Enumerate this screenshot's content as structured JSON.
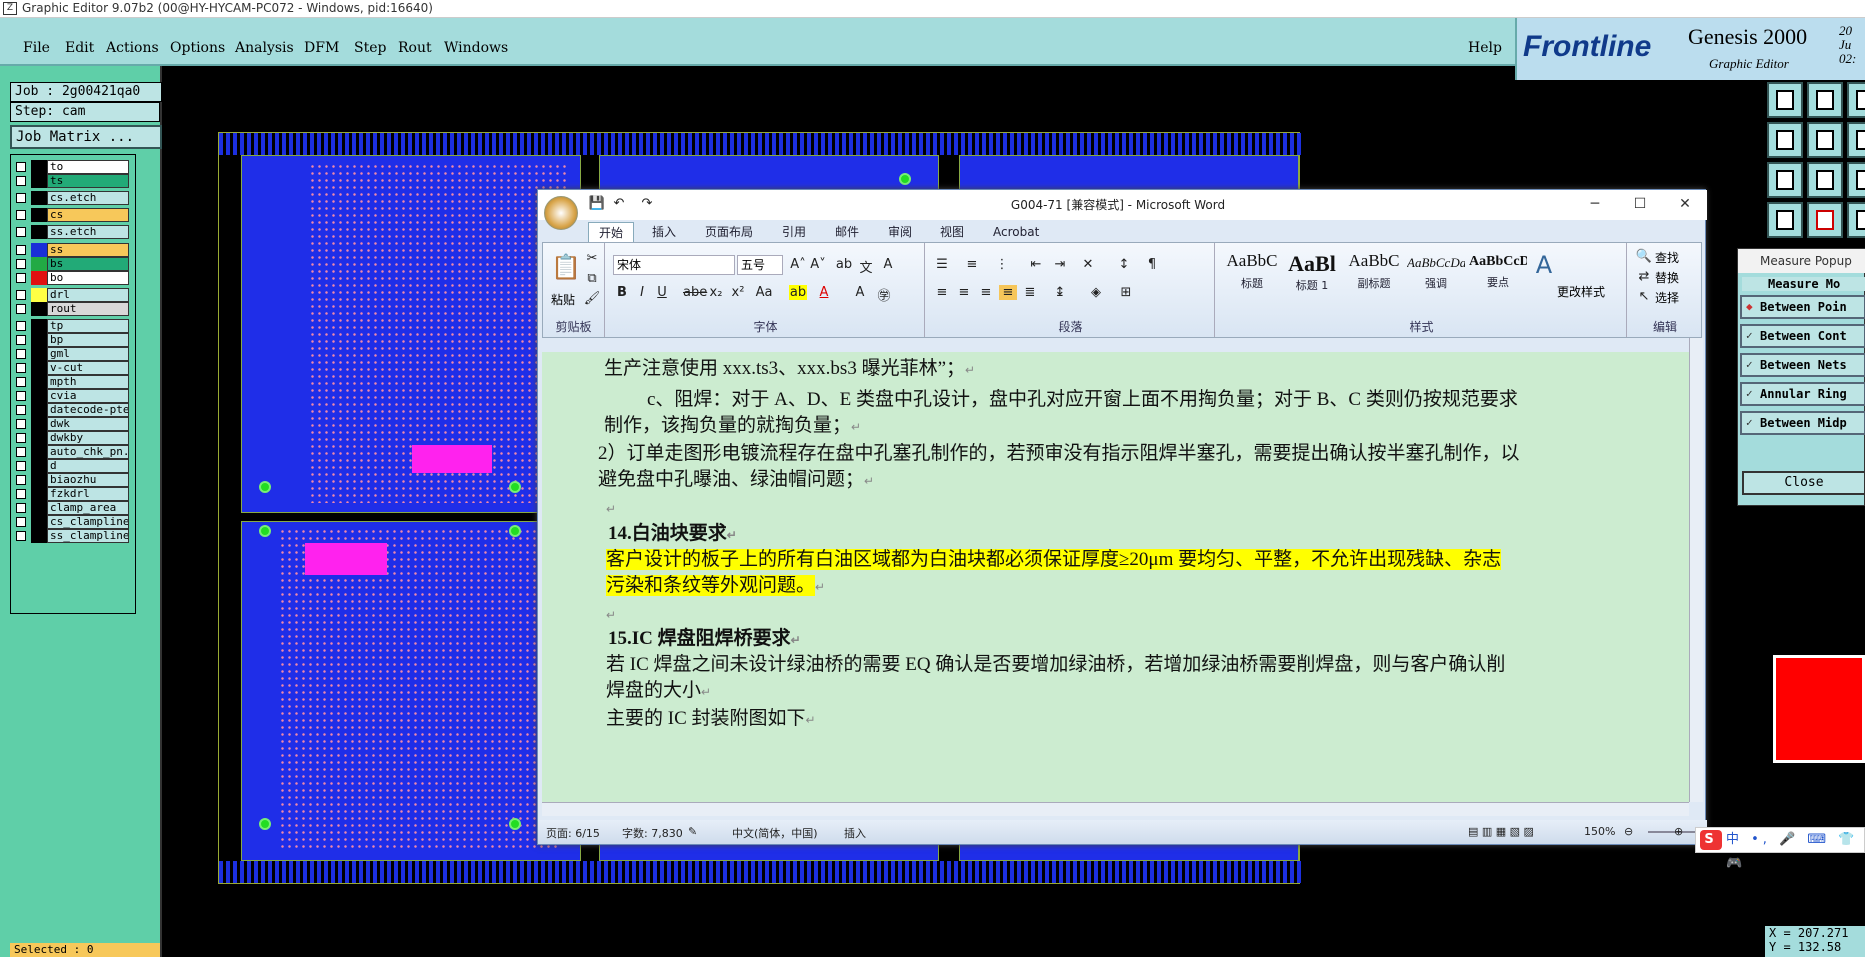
{
  "app": {
    "window_title": "Graphic Editor 9.07b2 (00@HY-HYCAM-PC072 - Windows, pid:16640)",
    "menu": [
      "File",
      "Edit",
      "Actions",
      "Options",
      "Analysis",
      "DFM",
      "Step",
      "Rout",
      "Windows"
    ],
    "help": "Help",
    "logo_brand": "Frontline",
    "logo_product": "Genesis 2000",
    "logo_sub": "Graphic Editor",
    "logo_date_1": "20 Ju",
    "logo_date_2": "02:"
  },
  "left": {
    "job": "Job : 2g00421qa0",
    "step": "Step: cam",
    "matrix": "Job Matrix ...",
    "selected": "Selected : 0",
    "layers": [
      {
        "name": "to",
        "color": "#000000",
        "bg": "#ffffff"
      },
      {
        "name": "ts",
        "color": "#000000",
        "bg": "#22aa77"
      },
      {
        "name": "cs.etch",
        "color": "#000000",
        "bg": "#bde4e4"
      },
      {
        "name": "cs",
        "color": "#000000",
        "bg": "#f7c85a"
      },
      {
        "name": "ss.etch",
        "color": "#000000",
        "bg": "#bde4e4"
      },
      {
        "name": "ss",
        "color": "#1a2fd8",
        "bg": "#f7c85a"
      },
      {
        "name": "bs",
        "color": "#22aa44",
        "bg": "#22aa77"
      },
      {
        "name": "bo",
        "color": "#e01010",
        "bg": "#ffffff"
      },
      {
        "name": "drl",
        "color": "#ffff44",
        "bg": "#bde4e4"
      },
      {
        "name": "rout",
        "color": "#000000",
        "bg": "#d8d8d8"
      },
      {
        "name": "tp",
        "color": "#000000",
        "bg": "#bde4e4"
      },
      {
        "name": "bp",
        "color": "#000000",
        "bg": "#bde4e4"
      },
      {
        "name": "gml",
        "color": "#000000",
        "bg": "#bde4e4"
      },
      {
        "name": "v-cut",
        "color": "#000000",
        "bg": "#bde4e4"
      },
      {
        "name": "mpth",
        "color": "#000000",
        "bg": "#bde4e4"
      },
      {
        "name": "cvia",
        "color": "#000000",
        "bg": "#bde4e4"
      },
      {
        "name": "datecode-pte",
        "color": "#000000",
        "bg": "#bde4e4"
      },
      {
        "name": "dwk",
        "color": "#000000",
        "bg": "#bde4e4"
      },
      {
        "name": "dwkby",
        "color": "#000000",
        "bg": "#bde4e4"
      },
      {
        "name": "auto_chk_pn.",
        "color": "#000000",
        "bg": "#bde4e4"
      },
      {
        "name": "d",
        "color": "#000000",
        "bg": "#bde4e4"
      },
      {
        "name": "biaozhu",
        "color": "#000000",
        "bg": "#bde4e4"
      },
      {
        "name": "fzkdrl",
        "color": "#000000",
        "bg": "#bde4e4"
      },
      {
        "name": "clamp_area",
        "color": "#000000",
        "bg": "#bde4e4"
      },
      {
        "name": "cs_clampline",
        "color": "#000000",
        "bg": "#bde4e4"
      },
      {
        "name": "ss_clampline",
        "color": "#000000",
        "bg": "#bde4e4"
      }
    ]
  },
  "word": {
    "title": "G004-71 [兼容模式] - Microsoft Word",
    "tabs": [
      "开始",
      "插入",
      "页面布局",
      "引用",
      "邮件",
      "审阅",
      "视图",
      "Acrobat"
    ],
    "font_name": "宋体",
    "font_size": "五号",
    "paste": "粘贴",
    "groups": {
      "clipboard": "剪贴板",
      "font": "字体",
      "paragraph": "段落",
      "styles": "样式",
      "editing": "编辑"
    },
    "styles": [
      {
        "sample": "AaBbC",
        "label": "标题"
      },
      {
        "sample": "AaBl",
        "label": "标题 1"
      },
      {
        "sample": "AaBbC",
        "label": "副标题"
      },
      {
        "sample": "AaBbCcDa",
        "label": "强调"
      },
      {
        "sample": "AaBbCcD",
        "label": "要点"
      }
    ],
    "change_styles": "更改样式",
    "find": "查找",
    "replace": "替换",
    "select": "选择",
    "lines": [
      "生产注意使用 xxx.ts3、xxx.bs3 曝光菲林”；",
      "c、阻焊：对于 A、D、E 类盘中孔设计，盘中孔对应开窗上面不用掏负量；对于 B、C 类则仍按规范要求",
      "制作，该掏负量的就掏负量；",
      "2）订单走图形电镀流程存在盘中孔塞孔制作的，若预审没有指示阻焊半塞孔，需要提出确认按半塞孔制作，以",
      "避免盘中孔曝油、绿油帽问题；",
      "14.白油块要求",
      "客户设计的板子上的所有白油区域都为白油块都必须保证厚度≥20μm 要均匀、平整，不允许出现残缺、杂志",
      "污染和条纹等外观问题。",
      "15.IC 焊盘阻焊桥要求",
      "若 IC 焊盘之间未设计绿油桥的需要 EQ 确认是否要增加绿油桥，若增加绿油桥需要削焊盘，则与客户确认削",
      "焊盘的大小",
      "主要的 IC 封装附图如下"
    ],
    "status": {
      "page": "页面: 6/15",
      "words": "字数: 7,830",
      "lang": "中文(简体，中国)",
      "mode": "插入",
      "zoom": "150%"
    }
  },
  "measure": {
    "window_title": "Measure Popup",
    "header": "Measure Mo",
    "items": [
      "Between Poin",
      "Between Cont",
      "Between Nets",
      "Annular Ring",
      "Between Midp"
    ],
    "close": "Close"
  },
  "coords": {
    "x": "X = 207.271",
    "y": "Y = 132.58"
  },
  "ime": {
    "text": "中 •, 🎤 ⌨ 👕 🎮"
  }
}
